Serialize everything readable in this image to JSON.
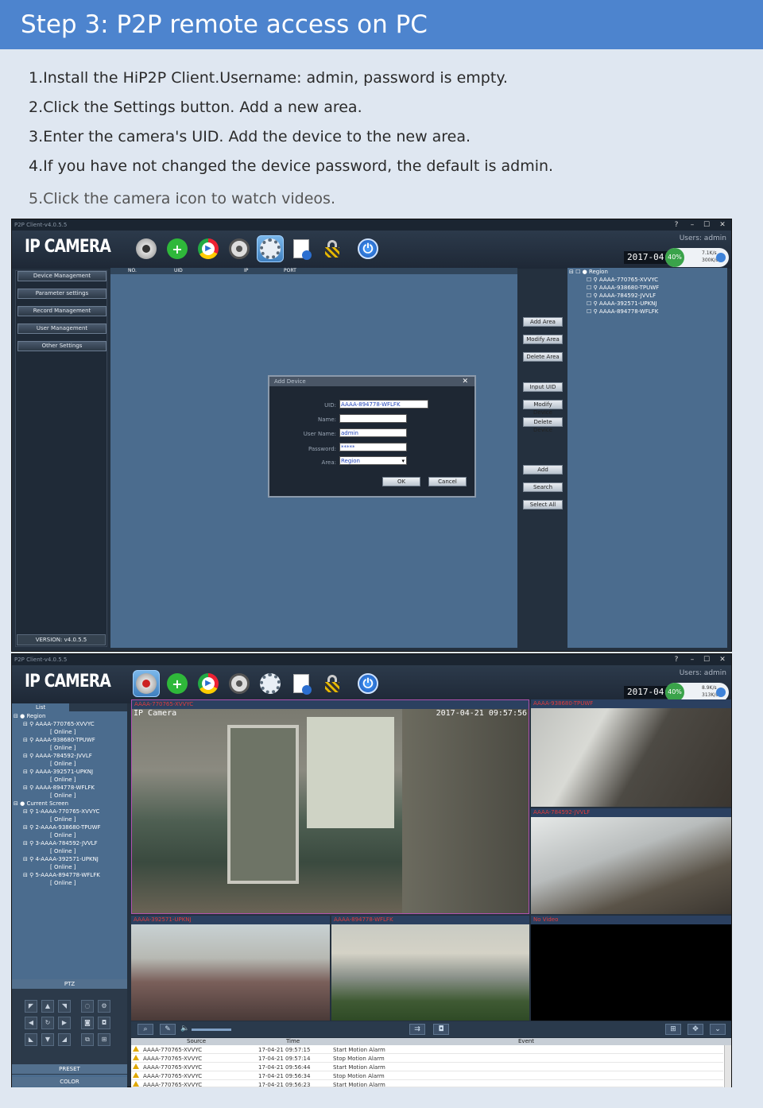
{
  "banner": {
    "title": "Step 3:  P2P remote access on PC"
  },
  "steps": [
    "1.Install the HiP2P Client.Username: admin, password is empty.",
    "2.Click the Settings button. Add a new area.",
    "3.Enter the camera's UID. Add the device to the new area.",
    "4.If you have not changed the device password, the default is admin.",
    "5.Click the camera icon to watch videos."
  ],
  "app": {
    "window_title": "P2P Client-v4.0.5.5",
    "logo": "IP CAMERA",
    "title_buttons": [
      "?",
      "–",
      "☐",
      "✕"
    ],
    "users": "Users: admin",
    "date": "2017-04-",
    "traffic_pct": "40%",
    "up_rate": "7.1K/s",
    "down_rate": "300K/s",
    "up_rate2": "8.9K/s",
    "down_rate2": "313K/s",
    "toolbar_icons": [
      "camera-view-icon",
      "add-icon",
      "playback-icon",
      "ptz-icon",
      "settings-icon",
      "log-icon",
      "lock-icon",
      "power-icon"
    ],
    "version": "VERSION: v4.0.5.5"
  },
  "settings": {
    "sidebar": [
      "Device Management",
      "Parameter settings",
      "Record Management",
      "User Management",
      "Other Settings"
    ],
    "columns": [
      "NO.",
      "UID",
      "IP",
      "PORT"
    ],
    "right_buttons": [
      "Add Area",
      "Modify Area",
      "Delete Area",
      "Input UID",
      "Modify Device",
      "Delete Device",
      "Add",
      "Search",
      "Select All"
    ],
    "tree_root": "Region",
    "tree_items": [
      "AAAA-770765-XVVYC",
      "AAAA-938680-TPUWF",
      "AAAA-784592-JVVLF",
      "AAAA-392571-UPKNJ",
      "AAAA-894778-WFLFK"
    ]
  },
  "dialog": {
    "title": "Add Device",
    "close": "✕",
    "fields": [
      {
        "label": "UID:",
        "value": "AAAA-894778-WFLFK"
      },
      {
        "label": "Name:",
        "value": ""
      },
      {
        "label": "User Name:",
        "value": "admin"
      },
      {
        "label": "Password:",
        "value": "*****"
      },
      {
        "label": "Area:",
        "value": "Region"
      }
    ],
    "ok": "OK",
    "cancel": "Cancel"
  },
  "live": {
    "list_tab": "List",
    "region": "Region",
    "online": "[   Online   ]",
    "devices": [
      "AAAA-770765-XVVYC",
      "AAAA-938680-TPUWF",
      "AAAA-784592-JVVLF",
      "AAAA-392571-UPKNJ",
      "AAAA-894778-WFLFK"
    ],
    "current_screen": "Current Screen",
    "screen_devices": [
      "1-AAAA-770765-XVVYC",
      "2-AAAA-938680-TPUWF",
      "3-AAAA-784592-JVVLF",
      "4-AAAA-392571-UPKNJ",
      "5-AAAA-894778-WFLFK"
    ],
    "ptz": "PTZ",
    "preset": "PRESET",
    "color": "COLOR",
    "videos": [
      {
        "title": "AAAA-770765-XVVYC",
        "osd_name": "IP Camera",
        "osd_time": "2017-04-21 09:57:56"
      },
      {
        "title": "AAAA-938680-TPUWF"
      },
      {
        "title": "AAAA-784592-JVVLF"
      },
      {
        "title": "AAAA-392571-UPKNJ"
      },
      {
        "title": "AAAA-894778-WFLFK"
      },
      {
        "title": "No Video"
      }
    ],
    "events": {
      "headers": [
        "Source",
        "Time",
        "Event"
      ],
      "rows": [
        {
          "source": "AAAA-770765-XVVYC",
          "time": "17-04-21 09:57:15",
          "event": "Start Motion Alarm"
        },
        {
          "source": "AAAA-770765-XVVYC",
          "time": "17-04-21 09:57:14",
          "event": "Stop Motion Alarm"
        },
        {
          "source": "AAAA-770765-XVVYC",
          "time": "17-04-21 09:56:44",
          "event": "Start Motion Alarm"
        },
        {
          "source": "AAAA-770765-XVVYC",
          "time": "17-04-21 09:56:34",
          "event": "Stop Motion Alarm"
        },
        {
          "source": "AAAA-770765-XVVYC",
          "time": "17-04-21 09:56:23",
          "event": "Start Motion Alarm"
        }
      ]
    }
  }
}
